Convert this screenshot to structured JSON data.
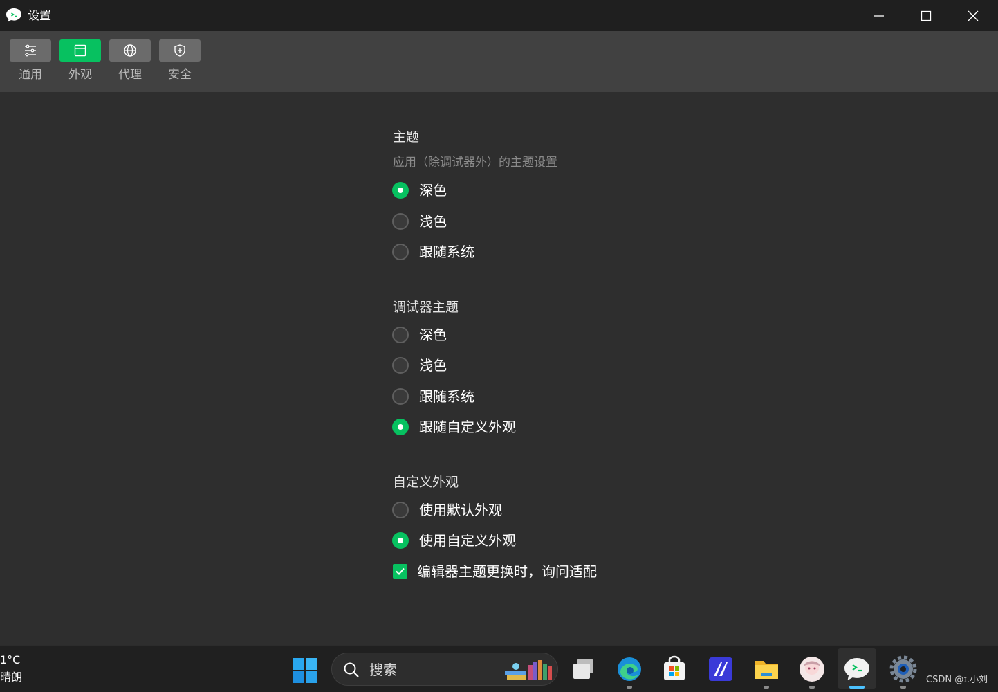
{
  "window": {
    "title": "设置",
    "controls": {
      "minimize": "minimize-icon",
      "maximize": "maximize-icon",
      "close": "close-icon"
    }
  },
  "tabs": [
    {
      "label": "通用",
      "icon": "sliders-icon",
      "active": false
    },
    {
      "label": "外观",
      "icon": "window-icon",
      "active": true
    },
    {
      "label": "代理",
      "icon": "globe-icon",
      "active": false
    },
    {
      "label": "安全",
      "icon": "shield-icon",
      "active": false
    }
  ],
  "sections": {
    "theme": {
      "title": "主题",
      "description": "应用（除调试器外）的主题设置",
      "options": [
        {
          "label": "深色",
          "checked": true
        },
        {
          "label": "浅色",
          "checked": false
        },
        {
          "label": "跟随系统",
          "checked": false
        }
      ]
    },
    "debugger_theme": {
      "title": "调试器主题",
      "options": [
        {
          "label": "深色",
          "checked": false
        },
        {
          "label": "浅色",
          "checked": false
        },
        {
          "label": "跟随系统",
          "checked": false
        },
        {
          "label": "跟随自定义外观",
          "checked": true
        }
      ]
    },
    "custom_appearance": {
      "title": "自定义外观",
      "options": [
        {
          "label": "使用默认外观",
          "checked": false
        },
        {
          "label": "使用自定义外观",
          "checked": true
        }
      ],
      "checkbox": {
        "label": "编辑器主题更换时，询问适配",
        "checked": true
      }
    }
  },
  "taskbar": {
    "weather_temp": "1°C",
    "weather_condition": "晴朗",
    "search_placeholder": "搜索",
    "apps": [
      "windows-start-icon",
      "task-view-icon",
      "edge-icon",
      "store-icon",
      "vscode-like-icon",
      "file-explorer-icon",
      "avatar-app-icon",
      "wechat-devtools-icon",
      "settings-gear-icon"
    ],
    "watermark": "CSDN @ɪ.小刘"
  },
  "colors": {
    "accent": "#07c160",
    "window_bg": "#2e2e2e",
    "toolbar_bg": "#414141",
    "titlebar_bg": "#1f1f1f"
  }
}
